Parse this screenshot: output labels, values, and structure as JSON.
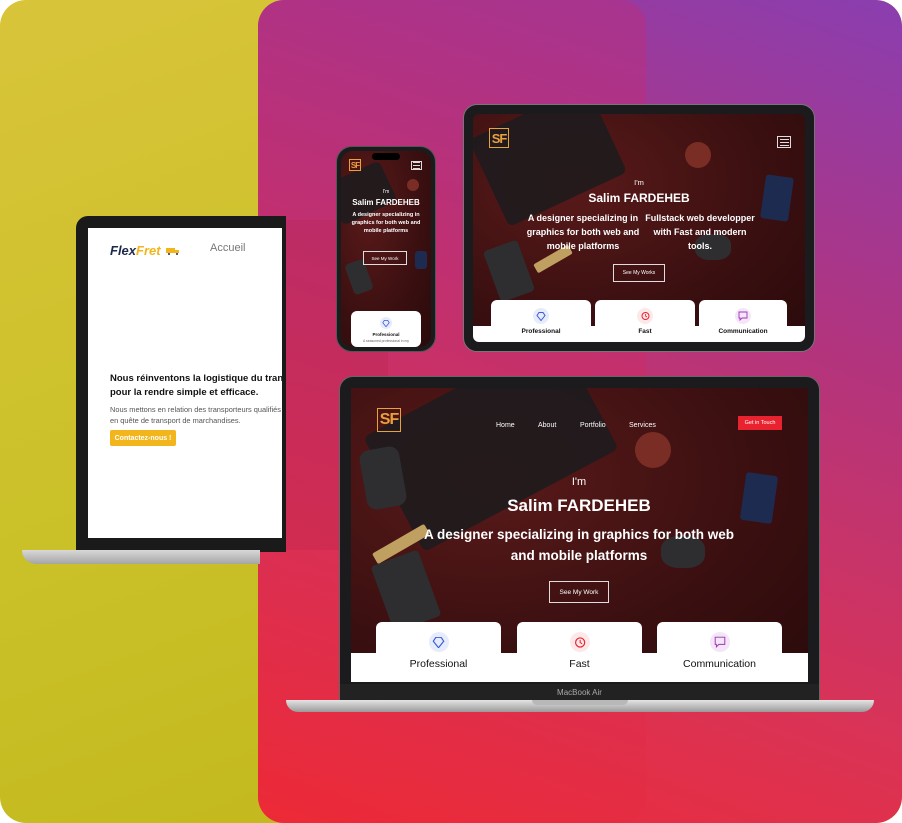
{
  "flexfret": {
    "logo_part1": "Flex",
    "logo_part2": "Fret",
    "nav_home": "Accueil",
    "headline": "Nous réinventons la logistique du transport routier pour la rendre simple et efficace.",
    "subtext": "Nous mettons en relation des transporteurs qualifiés avec des entreprises en quête de transport de marchandises.",
    "cta_label": "Contactez-nous !",
    "accent_color": "#f2b61c"
  },
  "portfolio": {
    "logo": "SF",
    "intro": "I'm",
    "name": "Salim FARDEHEB",
    "tagline": "A designer specializing in graphics for both web and mobile platforms",
    "tagline2": "Fullstack web developper with Fast and modern tools.",
    "see_work_mac": "See My Work",
    "see_work_phone": "See My Work",
    "see_work_tablet": "See My Works",
    "nav": [
      "Home",
      "About",
      "Portfolio",
      "Services"
    ],
    "cta": "Get in Touch",
    "cards": [
      {
        "title": "Professional",
        "icon": "diamond-icon",
        "color": "#3b5bdb"
      },
      {
        "title": "Fast",
        "icon": "clock-icon",
        "color": "#e8232f"
      },
      {
        "title": "Communication",
        "icon": "chat-icon",
        "color": "#9c36b5"
      }
    ],
    "phone_card_title": "Professional",
    "phone_card_text": "A seasoned professional in my"
  },
  "device_label": "MacBook Air",
  "colors": {
    "left_bg": "#cbc129",
    "right_bg_top": "#8a3eb0",
    "right_bg_bottom": "#ef2a34",
    "logo_orange": "#e9a13b"
  }
}
